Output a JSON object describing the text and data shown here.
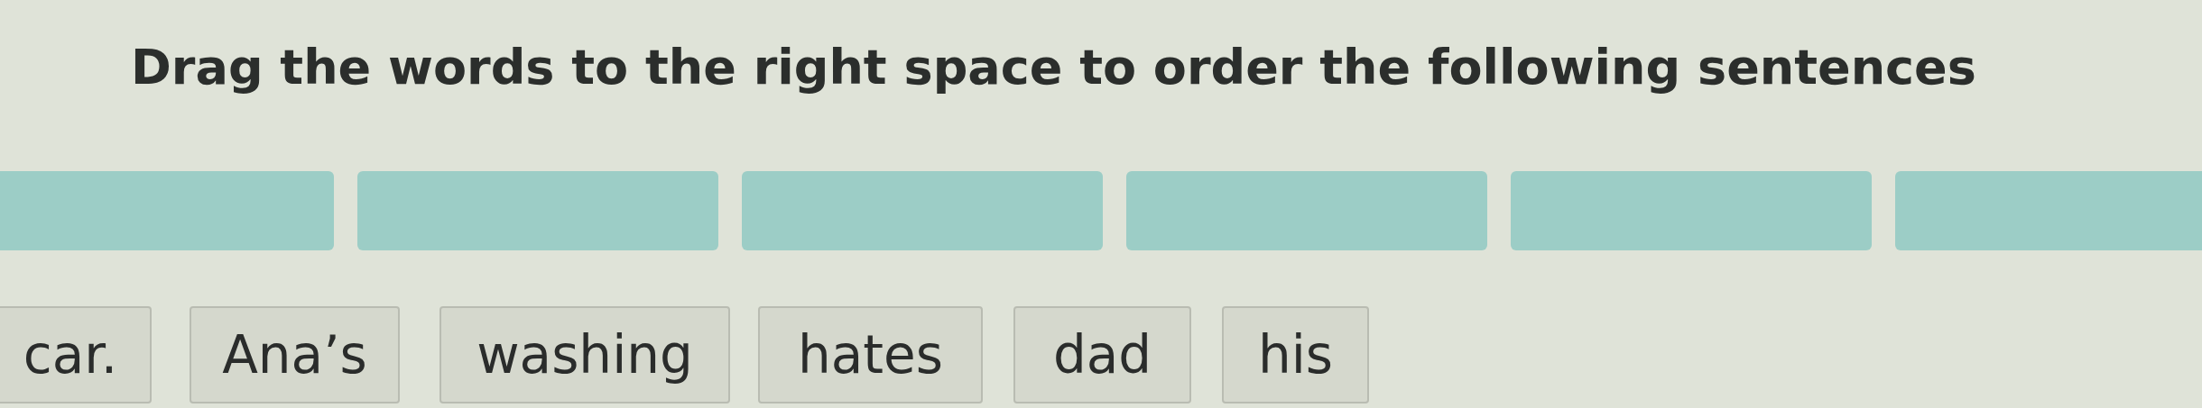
{
  "instruction": "Drag the words to the right space to order the following sentences",
  "slots": [
    {
      "filled": false
    },
    {
      "filled": false
    },
    {
      "filled": false
    },
    {
      "filled": false
    },
    {
      "filled": false
    },
    {
      "filled": false
    }
  ],
  "words": [
    "car.",
    "Ana’s",
    "washing",
    "hates",
    "dad",
    "his"
  ]
}
